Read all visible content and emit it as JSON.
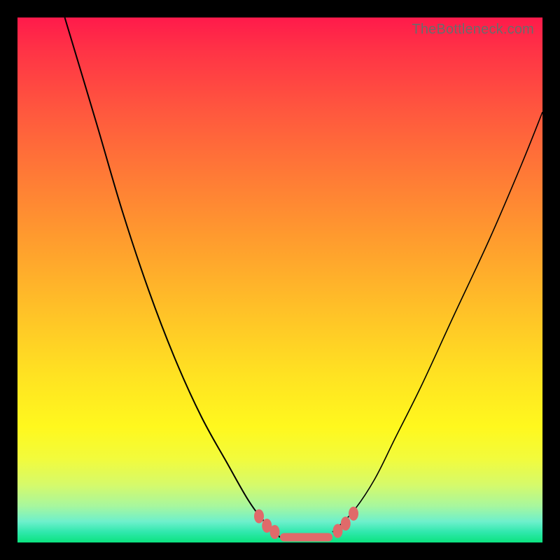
{
  "watermark": "TheBottleneck.com",
  "colors": {
    "frame": "#000000",
    "curve": "#000000",
    "marker": "#e06a6a",
    "gradient_top": "#ff1a4b",
    "gradient_bottom": "#0be37f"
  },
  "chart_data": {
    "type": "line",
    "title": "",
    "xlabel": "",
    "ylabel": "",
    "xlim": [
      0,
      100
    ],
    "ylim": [
      0,
      100
    ],
    "grid": false,
    "legend": null,
    "series": [
      {
        "name": "left-curve",
        "x": [
          9,
          15,
          20,
          25,
          30,
          35,
          40,
          44,
          47,
          50
        ],
        "y": [
          100,
          80,
          63,
          48,
          35,
          24,
          15,
          8,
          4,
          1
        ]
      },
      {
        "name": "right-curve",
        "x": [
          60,
          64,
          68,
          72,
          77,
          83,
          90,
          96,
          100
        ],
        "y": [
          2,
          6,
          12,
          20,
          30,
          43,
          58,
          72,
          82
        ]
      }
    ],
    "markers": {
      "name": "bottleneck-points",
      "points": [
        {
          "x": 46,
          "y": 5
        },
        {
          "x": 47.5,
          "y": 3.2
        },
        {
          "x": 49,
          "y": 2
        },
        {
          "x": 61,
          "y": 2.2
        },
        {
          "x": 62.5,
          "y": 3.6
        },
        {
          "x": 64,
          "y": 5.5
        }
      ]
    },
    "pill": {
      "name": "flat-bottom",
      "x_start": 50,
      "x_end": 60,
      "y": 1
    }
  }
}
